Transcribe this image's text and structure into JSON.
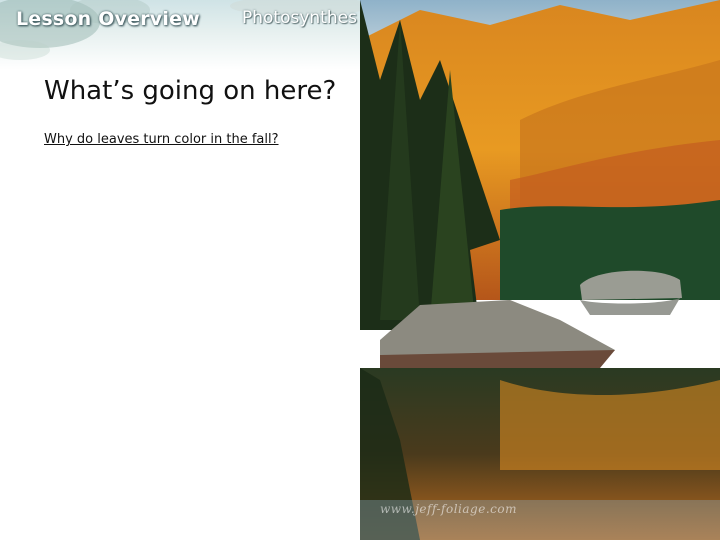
{
  "header": {
    "section_label": "Lesson Overview",
    "topic_label": "Photosynthes"
  },
  "slide": {
    "title": "What’s going on here?",
    "question": "Why do leaves turn color in the fall?"
  },
  "photo": {
    "subject": "autumn-foliage-lake",
    "watermark": "www.jeff-foliage.com"
  },
  "colors": {
    "title_text": "#111111",
    "header_text": "#ffffff"
  }
}
